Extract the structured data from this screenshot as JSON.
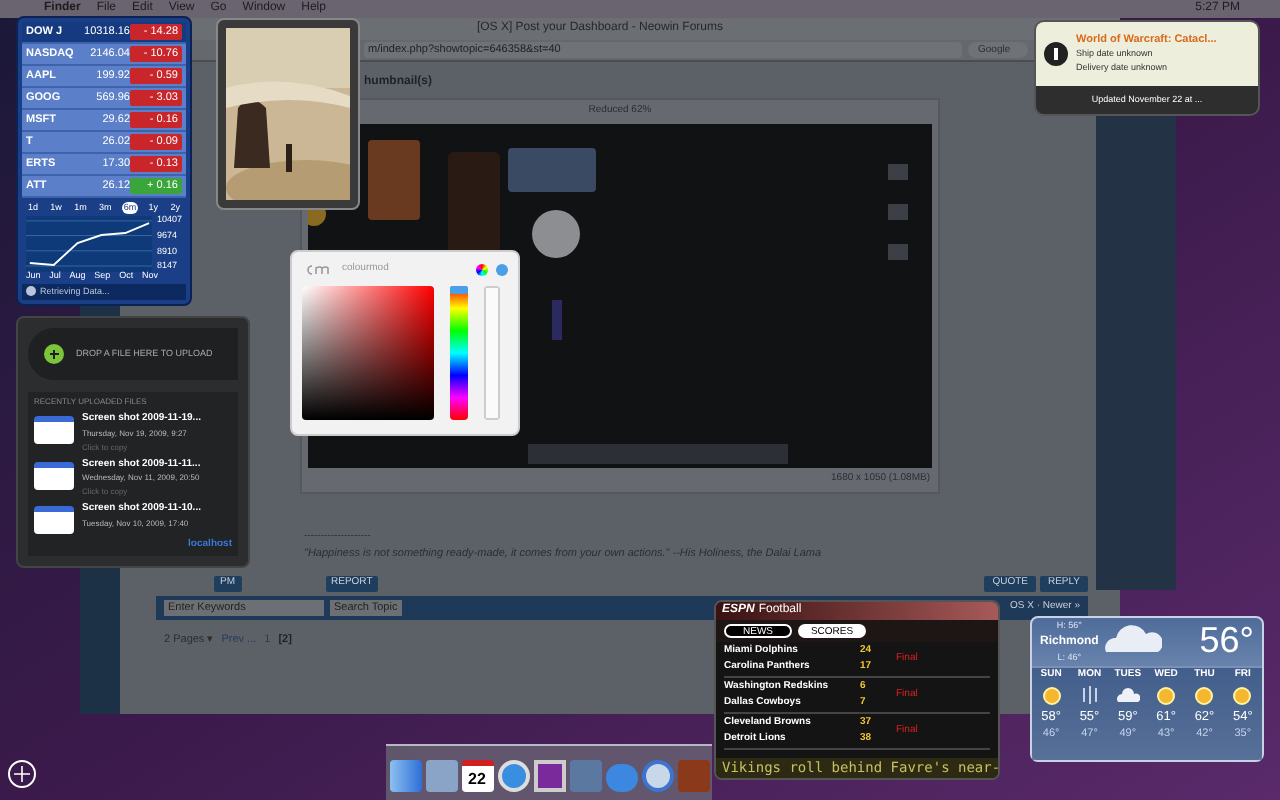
{
  "menu_bar": {
    "items": [
      "Finder",
      "File",
      "Edit",
      "View",
      "Go",
      "Window",
      "Help"
    ],
    "clock": "5:27 PM"
  },
  "browser": {
    "title": "[OS X] Post your Dashboard - Neowin Forums",
    "url": "m/index.php?showtopic=646358&st=40",
    "search": {
      "placeholder": "Google"
    },
    "heading": "humbnail(s)",
    "reduced": "Reduced 62%",
    "image_size": "1680 x 1050 (1.08MB)",
    "rule": "--------------------",
    "quote": "\"Happiness is not something ready-made, it comes from your own actions.\" --His Holiness, the Dalai Lama",
    "pm_button": "PM",
    "report_button": "REPORT",
    "reply_buttons": [
      "QUOTE",
      "REPLY"
    ],
    "keyword_search": {
      "placeholder": "Enter Keywords"
    },
    "search_button": "Search Topic",
    "pages": "2 Pages ▾",
    "prev": "Prev ...",
    "page_links": [
      {
        "label": "1",
        "selected": false
      },
      {
        "label": "[2]",
        "selected": true
      }
    ],
    "forum_nav": "OS X · Newer »"
  },
  "stocks": {
    "rows": [
      {
        "symbol": "DOW J",
        "price": "10318.16",
        "change": "- 14.28",
        "kind": "down",
        "selected": true
      },
      {
        "symbol": "NASDAQ",
        "price": "2146.04",
        "change": "- 10.76",
        "kind": "down",
        "selected": false
      },
      {
        "symbol": "AAPL",
        "price": "199.92",
        "change": "- 0.59",
        "kind": "down",
        "selected": false
      },
      {
        "symbol": "GOOG",
        "price": "569.96",
        "change": "- 3.03",
        "kind": "down",
        "selected": false
      },
      {
        "symbol": "MSFT",
        "price": "29.62",
        "change": "- 0.16",
        "kind": "down",
        "selected": false
      },
      {
        "symbol": "T",
        "price": "26.02",
        "change": "- 0.09",
        "kind": "down",
        "selected": false
      },
      {
        "symbol": "ERTS",
        "price": "17.30",
        "change": "- 0.13",
        "kind": "down",
        "selected": false
      },
      {
        "symbol": "ATT",
        "price": "26.12",
        "change": "+ 0.16",
        "kind": "up",
        "selected": false
      }
    ],
    "ranges": [
      {
        "label": "1d",
        "selected": false
      },
      {
        "label": "1w",
        "selected": false
      },
      {
        "label": "1m",
        "selected": false
      },
      {
        "label": "3m",
        "selected": false
      },
      {
        "label": "6m",
        "selected": true
      },
      {
        "label": "1y",
        "selected": false
      },
      {
        "label": "2y",
        "selected": false
      }
    ],
    "chart_data": {
      "type": "line",
      "categories": [
        "Jun",
        "Jul",
        "Aug",
        "Sep",
        "Oct",
        "Nov"
      ],
      "series": [
        {
          "color": "#ffffff",
          "values": [
            8300,
            8200,
            9300,
            9700,
            9800,
            10300
          ]
        }
      ],
      "ylim": [
        7900,
        10600
      ],
      "yticks": [
        8147,
        8910,
        9674,
        10407
      ]
    },
    "status": "Retrieving Data..."
  },
  "growl": {
    "title": "World of Warcraft: Catacl...",
    "lines": [
      "Ship date unknown",
      "Delivery date unknown"
    ],
    "footer": "Updated November 22 at ..."
  },
  "colourmod": {
    "title": "colourmod",
    "hue": {
      "level": 1
    },
    "alpha": {
      "level": 1
    }
  },
  "uploader": {
    "drop": "DROP A FILE HERE TO UPLOAD",
    "recent": "RECENTLY UPLOADED FILES",
    "files": [
      {
        "name": "Screen shot 2009-11-19...",
        "date": "Thursday, Nov 19, 2009, 9:27",
        "hint": "Click to copy"
      },
      {
        "name": "Screen shot 2009-11-11...",
        "date": "Wednesday, Nov 11, 2009, 20:50",
        "hint": "Click to copy"
      },
      {
        "name": "Screen shot 2009-11-10...",
        "date": "Tuesday, Nov 10, 2009, 17:40"
      }
    ],
    "footer": "localhost"
  },
  "espn": {
    "logo": "ESPN",
    "title": "Football",
    "tabs": [
      {
        "label": "NEWS",
        "selected": false
      },
      {
        "label": "SCORES",
        "selected": true
      }
    ],
    "games": [
      {
        "teams": [
          {
            "name": "Miami Dolphins",
            "score": "24"
          },
          {
            "name": "Carolina Panthers",
            "score": "17"
          }
        ],
        "status": "Final"
      },
      {
        "teams": [
          {
            "name": "Washington Redskins",
            "score": "6"
          },
          {
            "name": "Dallas Cowboys",
            "score": "7"
          }
        ],
        "status": "Final"
      },
      {
        "teams": [
          {
            "name": "Cleveland Browns",
            "score": "37"
          },
          {
            "name": "Detroit Lions",
            "score": "38"
          }
        ],
        "status": "Final"
      }
    ],
    "ticker": "Vikings roll behind Favre's near-"
  },
  "weather": {
    "high": "H: 56°",
    "city": "Richmond",
    "low": "L: 46°",
    "temp": "56°",
    "days": [
      {
        "day": "SUN",
        "kind": "sun",
        "high": "58°",
        "low": "46°"
      },
      {
        "day": "MON",
        "kind": "rain",
        "high": "55°",
        "low": "47°"
      },
      {
        "day": "TUES",
        "kind": "cloud",
        "high": "59°",
        "low": "49°"
      },
      {
        "day": "WED",
        "kind": "sun",
        "high": "61°",
        "low": "43°"
      },
      {
        "day": "THU",
        "kind": "sun",
        "high": "62°",
        "low": "42°"
      },
      {
        "day": "FRI",
        "kind": "sun",
        "high": "54°",
        "low": "35°"
      }
    ]
  },
  "dock": {
    "calendar_day": "22"
  }
}
